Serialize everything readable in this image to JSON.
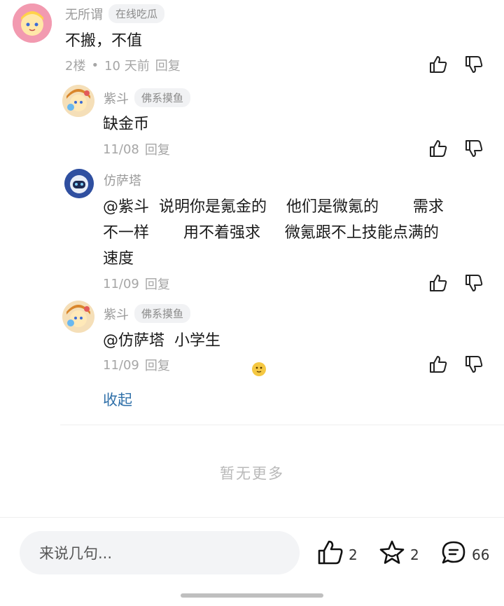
{
  "comments": [
    {
      "username": "无所谓",
      "tag": "在线吃瓜",
      "text": "不搬，不值",
      "floor": "2楼",
      "dot": "•",
      "time": "10 天前",
      "reply": "回复"
    },
    {
      "username": "紫斗",
      "tag": "佛系摸鱼",
      "text": "缺金币",
      "time": "11/08",
      "reply": "回复"
    },
    {
      "username": "仿萨塔",
      "text_line1": "@紫斗  说明你是氪金的    他们是微氪的       需求",
      "text_line2": "不一样       用不着强求     微氪跟不上技能点满的",
      "text_line3": "速度",
      "time": "11/09",
      "reply": "回复"
    },
    {
      "username": "紫斗",
      "tag": "佛系摸鱼",
      "text": "@仿萨塔  小学生",
      "time": "11/09",
      "reply": "回复"
    }
  ],
  "collapse_label": "收起",
  "no_more_label": "暂无更多",
  "bottom_bar": {
    "input_placeholder": "来说几句...",
    "like_count": "2",
    "favorite_count": "2",
    "comment_count": "66"
  },
  "icons": {
    "thumb_up": "thumb-up-icon",
    "thumb_down": "thumb-down-icon",
    "star": "star-icon",
    "comment": "comment-bubble-icon",
    "emoji": "smiley-emoji-icon"
  },
  "colors": {
    "link": "#2e6fa8",
    "meta": "#a6a6a6",
    "tag_bg": "#f1f2f4"
  }
}
